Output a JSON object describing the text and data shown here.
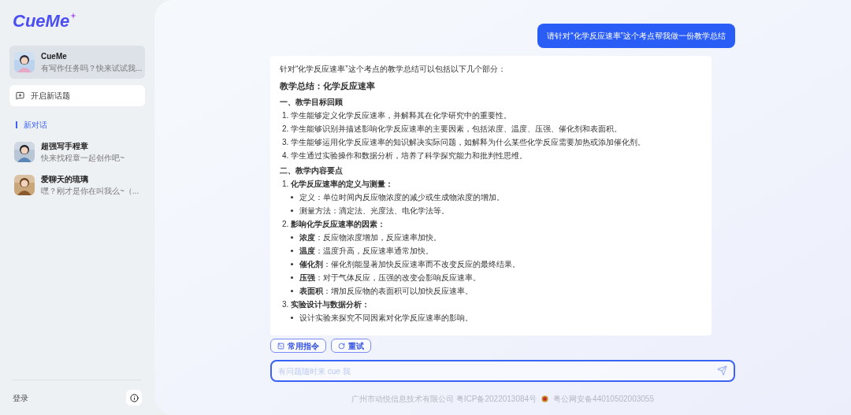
{
  "sidebar": {
    "logo": "CueMe",
    "pinned": {
      "name": "CueMe",
      "preview": "有写作任务吗？快来试试我...",
      "selected": true
    },
    "new_topic": "开启新话题",
    "section_label": "新对话",
    "chats": [
      {
        "name": "超强写手程章",
        "preview": "快来找程章一起创作吧~"
      },
      {
        "name": "爱聊天的琉璃",
        "preview": "嘿？刚才是你在叫我么~（..."
      }
    ],
    "login": "登录"
  },
  "conversation": {
    "user_message": "请针对“化学反应速率”这个考点帮我做一份教学总结",
    "reply": {
      "intro": "针对“化学反应速率”这个考点的教学总结可以包括以下几个部分：",
      "title": "教学总结：化学反应速率",
      "sections": [
        {
          "heading": "一、教学目标回顾",
          "items": [
            {
              "text": "1. 学生能够定义化学反应速率，并解释其在化学研究中的重要性。"
            },
            {
              "text": "2. 学生能够识别并描述影响化学反应速率的主要因素，包括浓度、温度、压强、催化剂和表面积。"
            },
            {
              "text": "3. 学生能够运用化学反应速率的知识解决实际问题，如解释为什么某些化学反应需要加热或添加催化剂。"
            },
            {
              "text": "4. 学生通过实验操作和数据分析，培养了科学探究能力和批判性思维。"
            }
          ]
        },
        {
          "heading": "二、教学内容要点",
          "items": [
            {
              "text": "1. **化学反应速率的定义与测量：**",
              "children": [
                {
                  "text": "定义：单位时间内反应物浓度的减少或生成物浓度的增加。"
                },
                {
                  "text": "测量方法：滴定法、光度法、电化学法等。"
                }
              ]
            },
            {
              "text": "2. **影响化学反应速率的因素：**",
              "children": [
                {
                  "text": "**浓度**：反应物浓度增加，反应速率加快。"
                },
                {
                  "text": "**温度**：温度升高，反应速率通常加快。"
                },
                {
                  "text": "**催化剂**：催化剂能显著加快反应速率而不改变反应的最终结果。"
                },
                {
                  "text": "**压强**：对于气体反应，压强的改变会影响反应速率。"
                },
                {
                  "text": "**表面积**：增加反应物的表面积可以加快反应速率。"
                }
              ]
            },
            {
              "text": "3. **实验设计与数据分析：**",
              "children": [
                {
                  "text": "设计实验来探究不同因素对化学反应速率的影响。"
                }
              ]
            }
          ]
        }
      ]
    },
    "actions": [
      "常用指令",
      "重试"
    ]
  },
  "input": {
    "placeholder": "有问题随时来 cue 我"
  },
  "footer": {
    "company": "广州市动悦信息技术有限公司 粤ICP备2022013084号",
    "police": "粤公网安备44010502003055"
  }
}
